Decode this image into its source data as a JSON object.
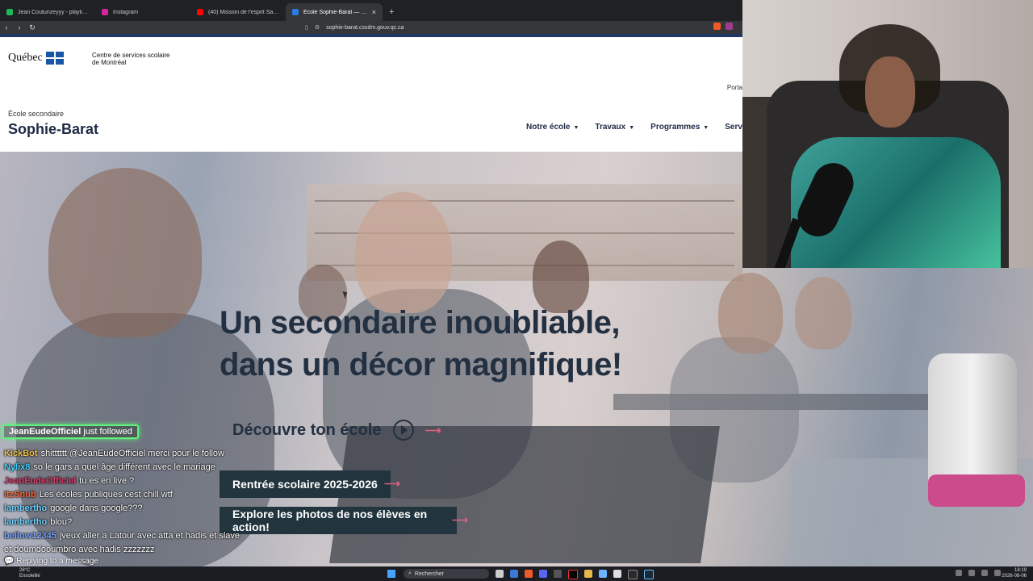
{
  "browser": {
    "tabs": [
      {
        "label": "Jean Couturizeyyy - playlist by vieso",
        "color": "#1db954"
      },
      {
        "label": "Instagram",
        "color": "#d6249f"
      },
      {
        "label": "(40) Mission de l'esprit Saint, Québec",
        "color": "#ff0000"
      },
      {
        "label": "École Sophie-Barat — École secondaire",
        "color": "#2a7de1"
      }
    ],
    "new_tab": "+",
    "url": "sophie-barat.cssdm.gouv.qc.ca"
  },
  "site": {
    "quebec_word": "Québec",
    "css_name_line1": "Centre de services scolaire",
    "css_name_line2": "de Montréal",
    "portal": "Porta",
    "school_sub": "École secondaire",
    "school_name": "Sophie-Barat",
    "nav": [
      "Notre école",
      "Travaux",
      "Programmes",
      "Servi"
    ],
    "headline_line1": "Un secondaire inoubliable,",
    "headline_line2": "dans un décor magnifique!",
    "discover": "Découvre ton école",
    "button1": "Rentrée scolaire 2025-2026",
    "button2": "Explore les photos de nos élèves en action!"
  },
  "chat": {
    "follow_user": "JeanEudeOfficiel",
    "follow_text": "just followed",
    "messages": [
      {
        "user": "KickBot",
        "text": "shitttttt @JeanEudeOfficiel merci pour le follow",
        "color": "#f0c24a"
      },
      {
        "user": "Nylix8",
        "text": "so le gars a quel âge différent avec le mariage",
        "color": "#44d0ff"
      },
      {
        "user": "JeanEudeOfficiel",
        "text": "tu es en live ?",
        "color": "#e03e6e"
      },
      {
        "user": "ItzSnub",
        "text": "Les écoles publiques cest chill wtf",
        "color": "#ff6a3d"
      },
      {
        "user": "lambertho",
        "text": "google dans google???",
        "color": "#6fd3ff"
      },
      {
        "user": "lambertho",
        "text": "blou?",
        "color": "#6fd3ff"
      },
      {
        "user": "bellow12345",
        "text": "jveux aller a Latour avec atta et hadis et slave et doumdooumbro avec hadis zzzzzzz",
        "color": "#7aa7ff"
      }
    ],
    "reply": "Replying to a message"
  },
  "taskbar": {
    "weather_temp": "28°C",
    "weather_desc": "Ensoleillé",
    "search_label": "Rechercher",
    "time": "18:19",
    "date": "2026-08-06"
  }
}
